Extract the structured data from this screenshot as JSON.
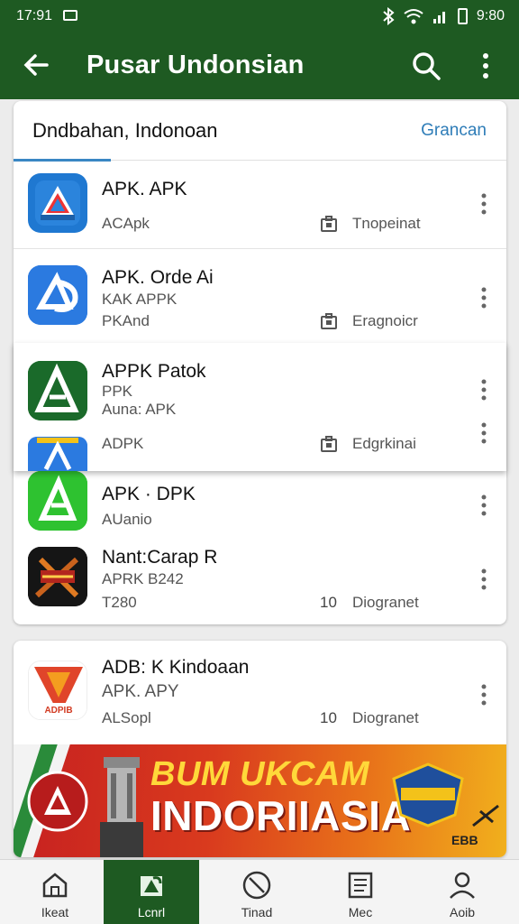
{
  "status_bar": {
    "time": "17:91",
    "battery": "9:80"
  },
  "app_bar": {
    "title": "Pusar Undonsian"
  },
  "list_card": {
    "heading": "Dndbahan, Indonoan",
    "action": "Grancan",
    "apps": [
      {
        "name": "APK. APK",
        "sub": "",
        "meta": "ACApk",
        "badge": "",
        "status": "Tnopeinat"
      },
      {
        "name": "APK. Orde Ai",
        "sub": "KAK APPK",
        "meta": "PKAnd",
        "badge": "",
        "status": "Eragnoicr"
      },
      {
        "name": "APPK Patok",
        "sub": "PPK",
        "meta": "Auna: APK",
        "badge": "",
        "status": ""
      },
      {
        "name": "",
        "sub": "",
        "meta": "ADPK",
        "badge": "",
        "status": "Edgrkinai"
      },
      {
        "name": "APK · DPK",
        "sub": "",
        "meta": "AUanio",
        "badge": "",
        "status": ""
      },
      {
        "name": "Nant:Carap R",
        "sub": "APRK B242",
        "meta": "T280",
        "badge": "10",
        "status": "Diogranet"
      }
    ]
  },
  "second_card": {
    "app": {
      "name": "ADB: K Kindoaan",
      "sub": "APK. APY",
      "meta": "ALSopl",
      "badge": "10",
      "status": "Diogranet"
    },
    "icon_text": "ADPIB",
    "banner": {
      "line1": "BUM UKCAM",
      "line2": "INDORIIASIA",
      "small": "EBB"
    }
  },
  "bottom_nav": [
    {
      "label": "Ikeat",
      "icon": "home-icon"
    },
    {
      "label": "Lcnrl",
      "icon": "apps-icon"
    },
    {
      "label": "Tinad",
      "icon": "clock-icon"
    },
    {
      "label": "Mec",
      "icon": "document-icon"
    },
    {
      "label": "Aoib",
      "icon": "person-icon"
    }
  ],
  "colors": {
    "primary": "#1e5a22",
    "accent": "#3a87c4",
    "banner_red": "#c62020",
    "banner_yellow": "#ffd83a"
  }
}
